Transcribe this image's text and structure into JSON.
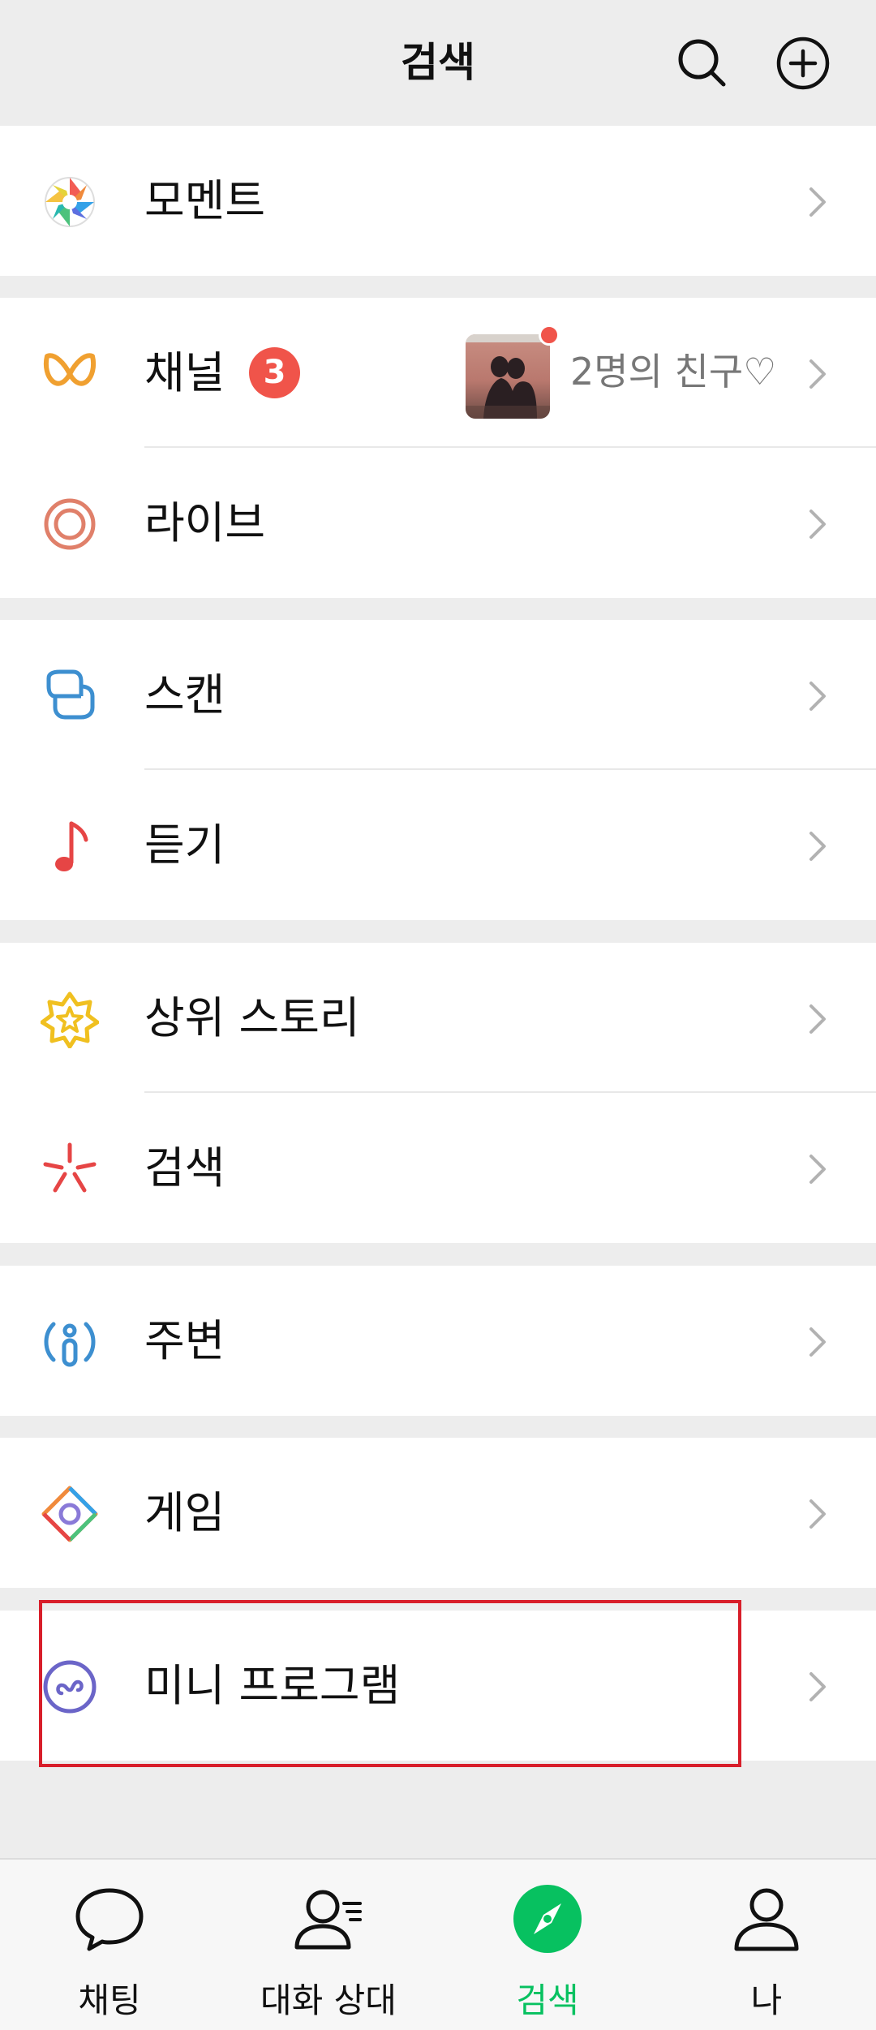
{
  "header": {
    "title": "검색",
    "search_icon": "search-icon",
    "add_icon": "plus-circle-icon"
  },
  "rows": {
    "moments": {
      "label": "모멘트",
      "icon": "aperture-icon"
    },
    "channels": {
      "label": "채널",
      "icon": "channels-icon",
      "badge": "3",
      "meta": "2명의 친구♡"
    },
    "live": {
      "label": "라이브",
      "icon": "live-icon"
    },
    "scan": {
      "label": "스캔",
      "icon": "scan-icon"
    },
    "listen": {
      "label": "듣기",
      "icon": "music-note-icon"
    },
    "top_stories": {
      "label": "상위 스토리",
      "icon": "top-stories-icon"
    },
    "search": {
      "label": "검색",
      "icon": "search-spark-icon"
    },
    "nearby": {
      "label": "주변",
      "icon": "nearby-icon"
    },
    "games": {
      "label": "게임",
      "icon": "game-icon"
    },
    "mini_programs": {
      "label": "미니 프로그램",
      "icon": "mini-program-icon"
    }
  },
  "tabbar": {
    "tabs": [
      {
        "label": "채팅",
        "icon": "chat-bubble-icon",
        "active": false
      },
      {
        "label": "대화 상대",
        "icon": "contacts-icon",
        "active": false
      },
      {
        "label": "검색",
        "icon": "compass-icon",
        "active": true
      },
      {
        "label": "나",
        "icon": "person-icon",
        "active": false
      }
    ]
  },
  "colors": {
    "accent": "#07c160",
    "badge": "#f0544a",
    "highlight": "#d81e2a",
    "background": "#ededed"
  }
}
